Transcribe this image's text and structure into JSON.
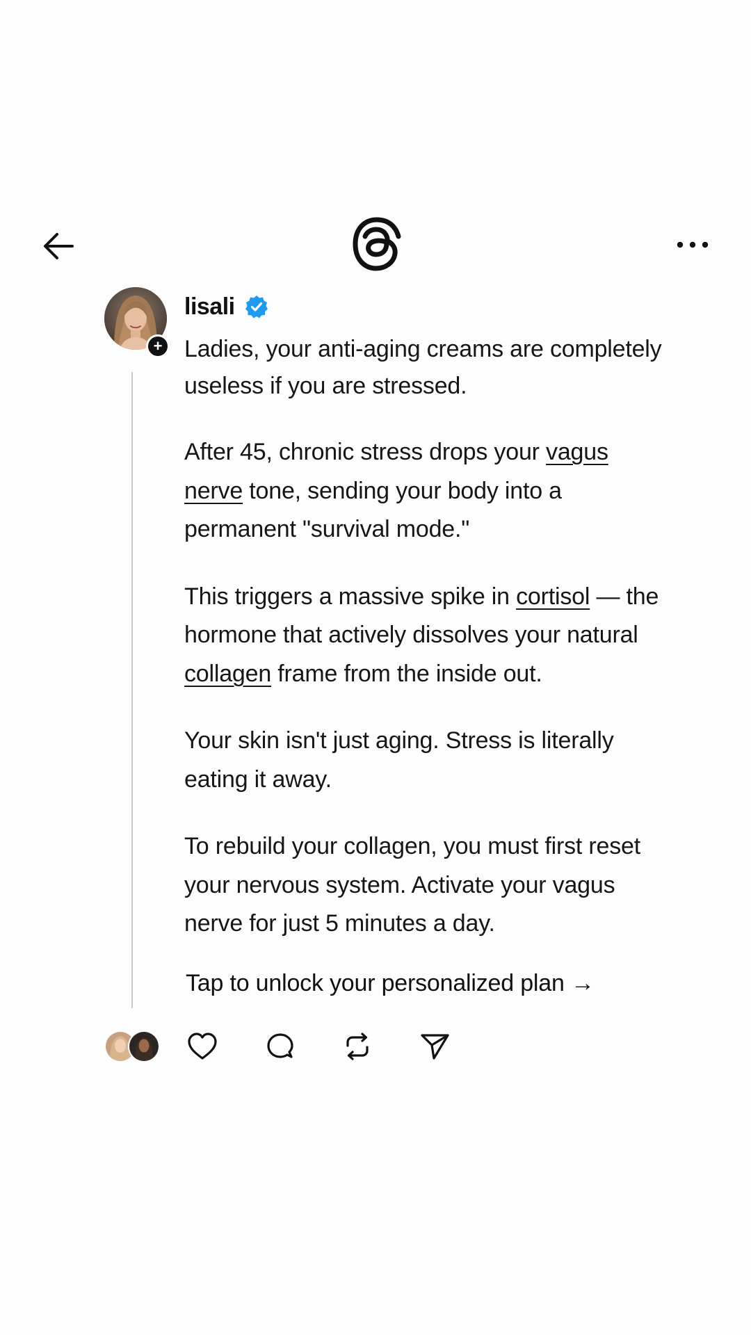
{
  "header": {
    "back_icon": "arrow-left-icon",
    "logo_icon": "threads-logo-icon",
    "more_icon": "more-horizontal-icon"
  },
  "post": {
    "author": {
      "username": "lisali",
      "verified": true,
      "verified_color": "#1d9bf0",
      "follow_icon": "plus-icon"
    },
    "paragraphs": [
      {
        "segments": [
          {
            "text": "Ladies, your anti-aging creams are completely useless if you are stressed."
          }
        ]
      },
      {
        "segments": [
          {
            "text": "After 45, chronic stress drops your "
          },
          {
            "text": "vagus nerve",
            "link": true
          },
          {
            "text": " tone, sending your body into a permanent \"survival mode.\""
          }
        ]
      },
      {
        "segments": [
          {
            "text": "This triggers a massive spike in "
          },
          {
            "text": "cortisol",
            "link": true
          },
          {
            "text": " — the hormone that actively dissolves your natural "
          },
          {
            "text": "collagen",
            "link": true
          },
          {
            "text": " frame from the inside out."
          }
        ]
      },
      {
        "segments": [
          {
            "text": "Your skin isn't just aging. Stress is literally eating it away."
          }
        ]
      },
      {
        "segments": [
          {
            "text": "To rebuild your collagen, you must first reset your nervous system. Activate your vagus nerve for just 5 minutes a day."
          }
        ]
      }
    ],
    "cta": "Tap to unlock your personalized plan →"
  },
  "actions": {
    "like_icon": "heart-icon",
    "reply_icon": "comment-bubble-icon",
    "repost_icon": "repost-icon",
    "share_icon": "send-icon"
  }
}
